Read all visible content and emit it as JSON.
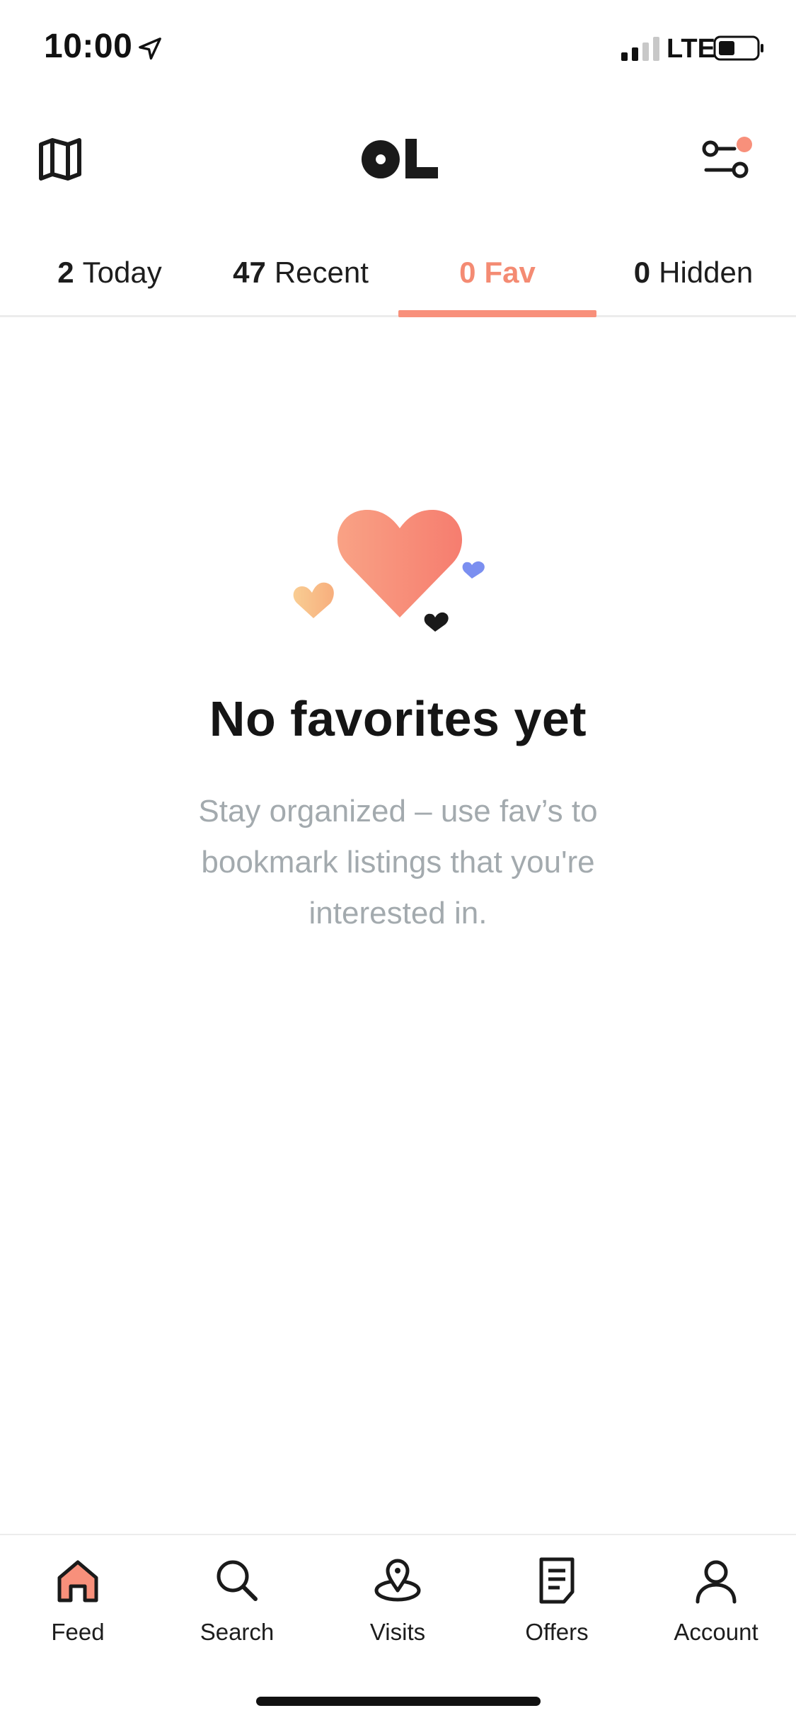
{
  "status_bar": {
    "time": "10:00",
    "network": "LTE"
  },
  "header": {
    "logo_text": "OL",
    "map_icon": "map-icon",
    "filter_icon": "filter-icon",
    "filter_badge_color": "#f8907b"
  },
  "tabs": [
    {
      "count": "2",
      "label": "Today",
      "active": false
    },
    {
      "count": "47",
      "label": "Recent",
      "active": false
    },
    {
      "count": "0",
      "label": "Fav",
      "active": true
    },
    {
      "count": "0",
      "label": "Hidden",
      "active": false
    }
  ],
  "empty_state": {
    "title": "No favorites yet",
    "description": "Stay organized – use fav’s to bookmark listings that you're interested in."
  },
  "bottom_nav": [
    {
      "label": "Feed",
      "icon": "home-icon",
      "active": true
    },
    {
      "label": "Search",
      "icon": "search-icon",
      "active": false
    },
    {
      "label": "Visits",
      "icon": "location-pin-icon",
      "active": false
    },
    {
      "label": "Offers",
      "icon": "document-icon",
      "active": false
    },
    {
      "label": "Account",
      "icon": "user-icon",
      "active": false
    }
  ],
  "colors": {
    "accent": "#f8907b",
    "accent_text": "#f48b73",
    "muted_text": "#a3aaae",
    "heart_blue": "#7b8ff0",
    "heart_peach": "#f9c08a"
  }
}
